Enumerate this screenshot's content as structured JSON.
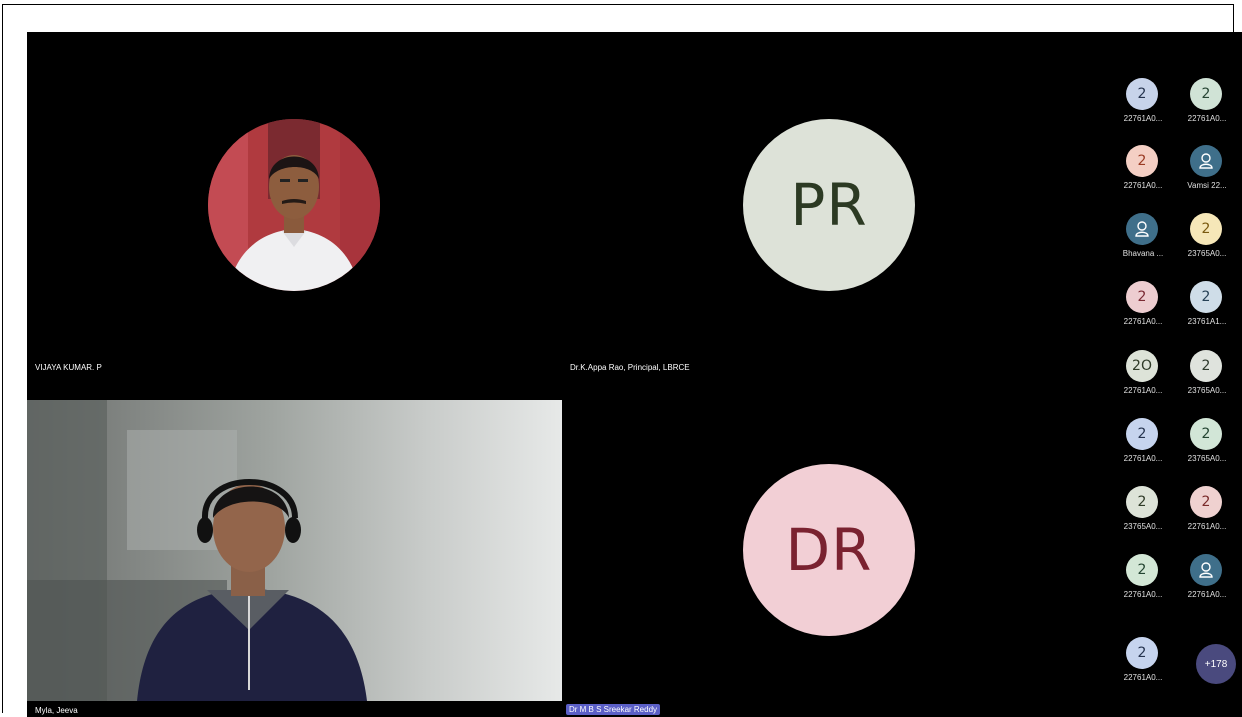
{
  "tiles": {
    "top_left": {
      "name": "VIJAYA KUMAR. P"
    },
    "top_right": {
      "name": "Dr.K.Appa Rao, Principal, LBRCE",
      "initials": "PR"
    },
    "bottom_left": {
      "name": "Myla, Jeeva"
    },
    "bottom_right": {
      "name": "Dr M B S Sreekar Reddy",
      "initials": "DR"
    }
  },
  "gallery": [
    {
      "initials": "2",
      "label": "22761A0...",
      "bg": "#c7d3ea",
      "fg": "#26344f"
    },
    {
      "initials": "2",
      "label": "22761A0...",
      "bg": "#d0e3d6",
      "fg": "#264534"
    },
    {
      "initials": "2",
      "label": "22761A0...",
      "bg": "#f4cfc4",
      "fg": "#9a3b24"
    },
    {
      "icon": "person-icon",
      "label": "Vamsi 22...",
      "bg": "#3f6f8a",
      "fg": "#ffffff"
    },
    {
      "icon": "person-icon",
      "label": "Bhavana ...",
      "bg": "#3f6f8a",
      "fg": "#ffffff"
    },
    {
      "initials": "2",
      "label": "23765A0...",
      "bg": "#f6e7b8",
      "fg": "#7a5a10"
    },
    {
      "initials": "2",
      "label": "22761A0...",
      "bg": "#edcdd0",
      "fg": "#7a2a34"
    },
    {
      "initials": "2",
      "label": "23761A1...",
      "bg": "#cfdde8",
      "fg": "#274156"
    },
    {
      "initials": "2O",
      "label": "22761A0...",
      "bg": "#dde3d8",
      "fg": "#2f3b28"
    },
    {
      "initials": "2",
      "label": "23765A0...",
      "bg": "#dfe3dd",
      "fg": "#2f3b2e"
    },
    {
      "initials": "2",
      "label": "22761A0...",
      "bg": "#c6d4ee",
      "fg": "#26344f"
    },
    {
      "initials": "2",
      "label": "23765A0...",
      "bg": "#d2e6d7",
      "fg": "#244532"
    },
    {
      "initials": "2",
      "label": "23765A0...",
      "bg": "#dde3d8",
      "fg": "#2f3b28"
    },
    {
      "initials": "2",
      "label": "22761A0...",
      "bg": "#efd1d0",
      "fg": "#7a2a2a"
    },
    {
      "initials": "2",
      "label": "22761A0...",
      "bg": "#d3e7d6",
      "fg": "#244532"
    },
    {
      "icon": "person-icon",
      "label": "22761A0...",
      "bg": "#3f6f8a",
      "fg": "#ffffff"
    },
    {
      "initials": "2",
      "label": "22761A0...",
      "bg": "#c6d4ee",
      "fg": "#26344f"
    }
  ],
  "overflow_count": "+178",
  "colors": {
    "pr_avatar_bg": "#dde2d8",
    "pr_avatar_fg": "#2c3a23",
    "dr_avatar_bg": "#f2cfd5",
    "dr_avatar_fg": "#7a2230",
    "name_highlight": "#5b5fc7"
  }
}
